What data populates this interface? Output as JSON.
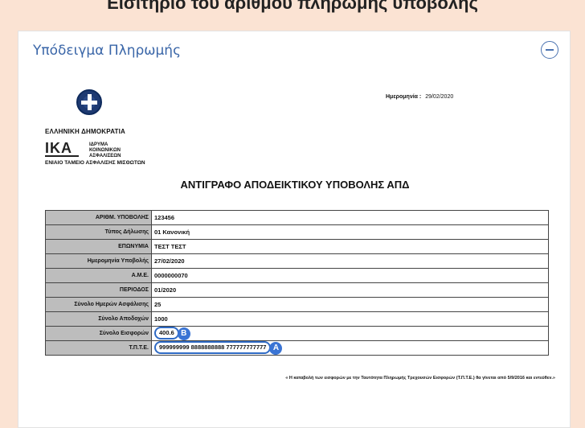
{
  "top_heading": "Εισιτήριο του αριθμού πληρωμής υποβολής",
  "panel": {
    "title": "Υπόδειγμα Πληρωμής"
  },
  "document": {
    "date_label": "Ημερομηνία :",
    "date_value": "29/02/2020",
    "republic": "ΕΛΛΗΝΙΚΗ ΔΗΜΟΚΡΑΤΙΑ",
    "ika_logo": "ΙΚΑ",
    "ika_lines": [
      "ΙΔΡΥΜΑ",
      "ΚΟΙΝΩΝΙΚΩΝ",
      "ΑΣΦΑΛΙΣΕΩΝ"
    ],
    "fund_name": "ΕΝΙΑΙΟ ΤΑΜΕΙΟ ΑΣΦΑΛΙΣΗΣ ΜΙΣΘΩΤΩΝ",
    "title": "ΑΝΤΙΓΡΑΦΟ ΑΠΟΔΕΙΚΤΙΚΟΥ ΥΠΟΒΟΛΗΣ ΑΠΔ",
    "rows": [
      {
        "label": "ΑΡΙΘΜ. ΥΠΟΒΟΛΗΣ",
        "value": "123456"
      },
      {
        "label": "Τύπος Δήλωσης",
        "value": "01 Κανονική"
      },
      {
        "label": "ΕΠΩΝΥΜΙΑ",
        "value": "ΤΕΣΤ ΤΕΣΤ"
      },
      {
        "label": "Ημερομηνία Υποβολής",
        "value": "27/02/2020"
      },
      {
        "label": "Α.Μ.Ε.",
        "value": "0000000070"
      },
      {
        "label": "ΠΕΡΙΟΔΟΣ",
        "value": "01/2020"
      },
      {
        "label": "Σύνολο Ημερών Ασφάλισης",
        "value": "25"
      },
      {
        "label": "Σύνολο Αποδοχών",
        "value": "1000"
      },
      {
        "label": "Σύνολο Εισφορών",
        "value": "400.6"
      },
      {
        "label": "Τ.Π.Τ.Ε.",
        "value": "999999999 8888888888 777777777777"
      }
    ],
    "marker_b": "B",
    "marker_a": "A",
    "footnote": "« Η καταβολή των εισφορών με την Ταυτότητα Πληρωμής Τρεχουσών Εισφορών (Τ.Π.Τ.Ε.) θα γίνεται από 5/9/2016 και εντεύθεν.»"
  },
  "colors": {
    "background": "#fbe3d3",
    "accent": "#3a74d4",
    "title_blue": "#3a66a8"
  },
  "icons": {
    "collapse": "minus-circle-icon",
    "emblem": "greek-emblem-icon"
  }
}
